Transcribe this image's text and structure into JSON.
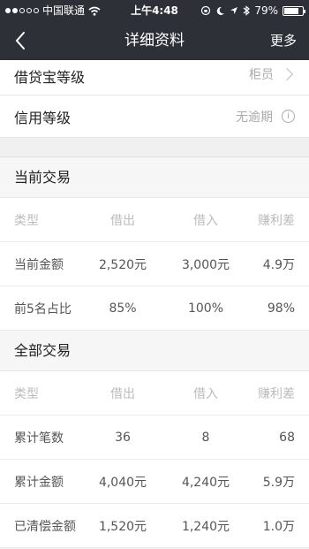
{
  "status_bar": {
    "carrier": "中国联通",
    "time": "上午4:48",
    "battery": "79%",
    "battery_level": 0.79
  },
  "nav": {
    "title": "详细资料",
    "more": "更多"
  },
  "info_rows": [
    {
      "label": "借贷宝等级",
      "value": "柜员"
    },
    {
      "label": "信用等级",
      "value": "无逾期"
    }
  ],
  "current_trade": {
    "title": "当前交易",
    "columns": [
      "类型",
      "借出",
      "借入",
      "赚利差"
    ],
    "rows": [
      [
        "当前金额",
        "2,520元",
        "3,000元",
        "4.9万"
      ],
      [
        "前5名占比",
        "85%",
        "100%",
        "98%"
      ]
    ]
  },
  "all_trade": {
    "title": "全部交易",
    "columns": [
      "类型",
      "借出",
      "借入",
      "赚利差"
    ],
    "rows": [
      [
        "累计笔数",
        "36",
        "8",
        "68"
      ],
      [
        "累计金额",
        "4,040元",
        "4,240元",
        "5.9万"
      ],
      [
        "已清偿金额",
        "1,520元",
        "1,240元",
        "1.0万"
      ]
    ]
  }
}
